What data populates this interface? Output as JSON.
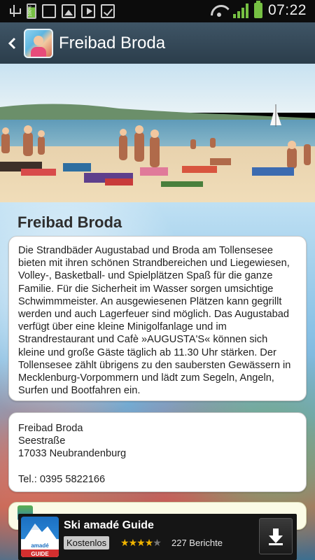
{
  "status_bar": {
    "time": "07:22",
    "icons": [
      "usb-icon",
      "battery-icon",
      "sim-card-icon",
      "image-icon",
      "play-store-icon",
      "check-icon",
      "wifi-icon",
      "signal-icon",
      "battery-icon"
    ],
    "battery_level_text": "100%"
  },
  "action_bar": {
    "title": "Freibad Broda",
    "background_color": "#34495a"
  },
  "content": {
    "section_title": "Freibad Broda",
    "description": "Die Strandbäder Augustabad und Broda am Tollensesee bieten mit ihren schönen Strandbereichen und Liegewiesen, Volley-, Basketball- und Spielplätzen Spaß für die ganze Familie. Für die Sicherheit im Wasser sorgen umsichtige Schwimmmeister. An ausgewiesenen Plätzen kann gegrillt werden und auch Lagerfeuer sind möglich. Das Augustabad verfügt über eine kleine Minigolfanlage und im Strandrestaurant und Cafè »AUGUSTA'S« können sich kleine und große Gäste täglich ab 11.30 Uhr stärken. Der Tollensesee zählt übrigens zu den saubersten Gewässern in Mecklenburg-Vorpommern und lädt zum Segeln, Angeln, Surfen und Bootfahren ein.",
    "address": {
      "name": "Freibad Broda",
      "street": "Seestraße",
      "city": "17033 Neubrandenburg",
      "phone": "Tel.: 0395 5822166"
    }
  },
  "ad": {
    "title": "Ski amadé Guide",
    "price_label": "Kostenlos",
    "rating": 4,
    "rating_max": 5,
    "reviews": "227 Berichte",
    "icon_text": "amadé",
    "icon_subtext": "GUIDE"
  }
}
